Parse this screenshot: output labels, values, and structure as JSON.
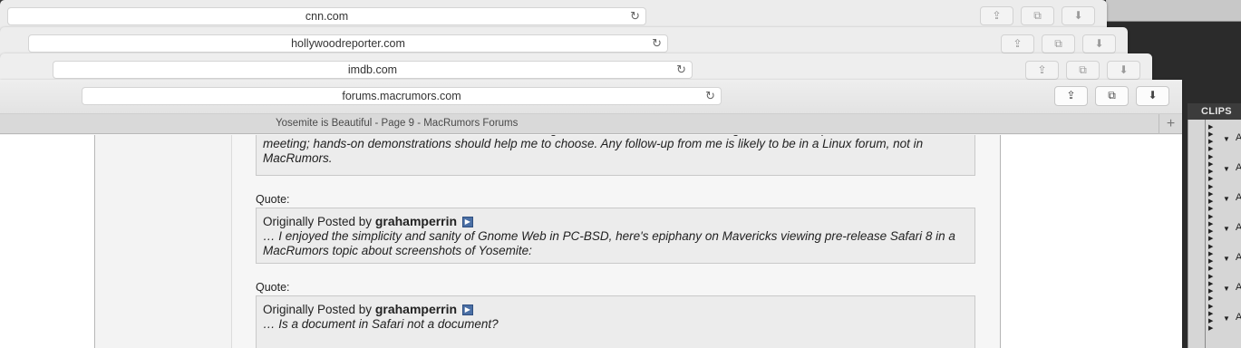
{
  "windows": [
    {
      "url": "cnn.com"
    },
    {
      "url": "hollywoodreporter.com"
    },
    {
      "url": "imdb.com"
    },
    {
      "url": "forums.macrumors.com"
    }
  ],
  "active_tab": {
    "title": "Yosemite is Beautiful - Page 9 - MacRumors Forums",
    "new_tab_symbol": "+"
  },
  "icons": {
    "reload": "↻",
    "share": "⇪",
    "tabs": "⧉",
    "download": "⬇"
  },
  "clips_panel": {
    "title": "CLIPS",
    "row_letter": "A",
    "rows": 7
  },
  "content": {
    "top_quote_text": "combined. I'm familiar with Ubuntu but the overall range of distributions is mind-numbing. Next week I'll plan to attend a local LUG meeting; hands-on demonstrations should help me to choose. Any follow-up from me is likely to be in a Linux forum, not in MacRumors.",
    "quotes": [
      {
        "label": "Quote:",
        "originally_posted_by": "Originally Posted by",
        "author": "grahamperrin",
        "text": "… I enjoyed the simplicity and sanity of Gnome Web in PC-BSD, here's epiphany on Mavericks viewing pre-release Safari 8 in a MacRumors topic about screenshots of Yosemite:"
      },
      {
        "label": "Quote:",
        "originally_posted_by": "Originally Posted by",
        "author": "grahamperrin",
        "text": "… Is a document in Safari not a document?"
      }
    ]
  }
}
